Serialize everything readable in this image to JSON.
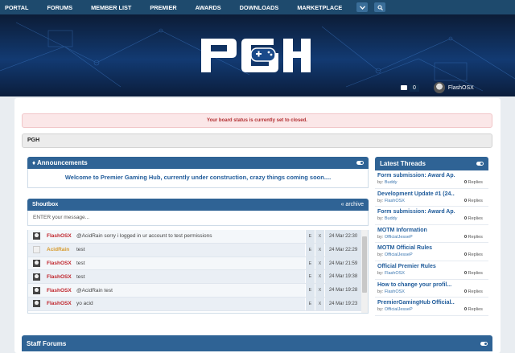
{
  "nav": {
    "items": [
      "PORTAL",
      "FORUMS",
      "MEMBER LIST",
      "PREMIER",
      "AWARDS",
      "DOWNLOADS",
      "MARKETPLACE"
    ]
  },
  "user": {
    "mail_count": "0",
    "name": "FlashOSX"
  },
  "board_status": "Your board status is currently set to closed.",
  "breadcrumb": "PGH",
  "announcements": {
    "title": "Announcements",
    "message": "Welcome to Premier Gaming Hub, currently under construction, crazy things coming soon...."
  },
  "shoutbox": {
    "title": "Shoutbox",
    "archive_label": "« archive",
    "input_placeholder": "ENTER your message...",
    "edit_label": "E",
    "delete_label": "X",
    "rows": [
      {
        "user": "FlashOSX",
        "user_color": "#c0262d",
        "message": "@AcidRain sorry i logged in ur account to test permissions",
        "date": "24 Mar 22:30"
      },
      {
        "user": "AcidRain",
        "user_color": "#d79a2b",
        "message": "test",
        "date": "24 Mar 22:29"
      },
      {
        "user": "FlashOSX",
        "user_color": "#c0262d",
        "message": "test",
        "date": "24 Mar 21:59"
      },
      {
        "user": "FlashOSX",
        "user_color": "#c0262d",
        "message": "test",
        "date": "24 Mar 19:38"
      },
      {
        "user": "FlashOSX",
        "user_color": "#c0262d",
        "message": "@AcidRain test",
        "date": "24 Mar 19:28"
      },
      {
        "user": "FlashOSX",
        "user_color": "#c0262d",
        "message": "yo acid",
        "date": "24 Mar 19:23"
      }
    ]
  },
  "latest_threads": {
    "title": "Latest Threads",
    "by_label": "by:",
    "replies_label": "Replies",
    "items": [
      {
        "title": "Form submission: Award Ap...",
        "by": "Buddy",
        "replies": "0"
      },
      {
        "title": "Development Update #1 (24...",
        "by": "FlashOSX",
        "replies": "0"
      },
      {
        "title": "Form submission: Award Ap...",
        "by": "Buddy",
        "replies": "0"
      },
      {
        "title": "MOTM Information",
        "by": "OfficialJesseP",
        "replies": "0"
      },
      {
        "title": "MOTM Official Rules",
        "by": "OfficialJesseP",
        "replies": "0"
      },
      {
        "title": "Official Premier Rules",
        "by": "FlashOSX",
        "replies": "0"
      },
      {
        "title": "How to change your profil...",
        "by": "FlashOSX",
        "replies": "0"
      },
      {
        "title": "PremierGamingHub Official...",
        "by": "OfficialJesseP",
        "replies": "0"
      }
    ]
  },
  "staff_forums": {
    "title": "Staff Forums"
  }
}
